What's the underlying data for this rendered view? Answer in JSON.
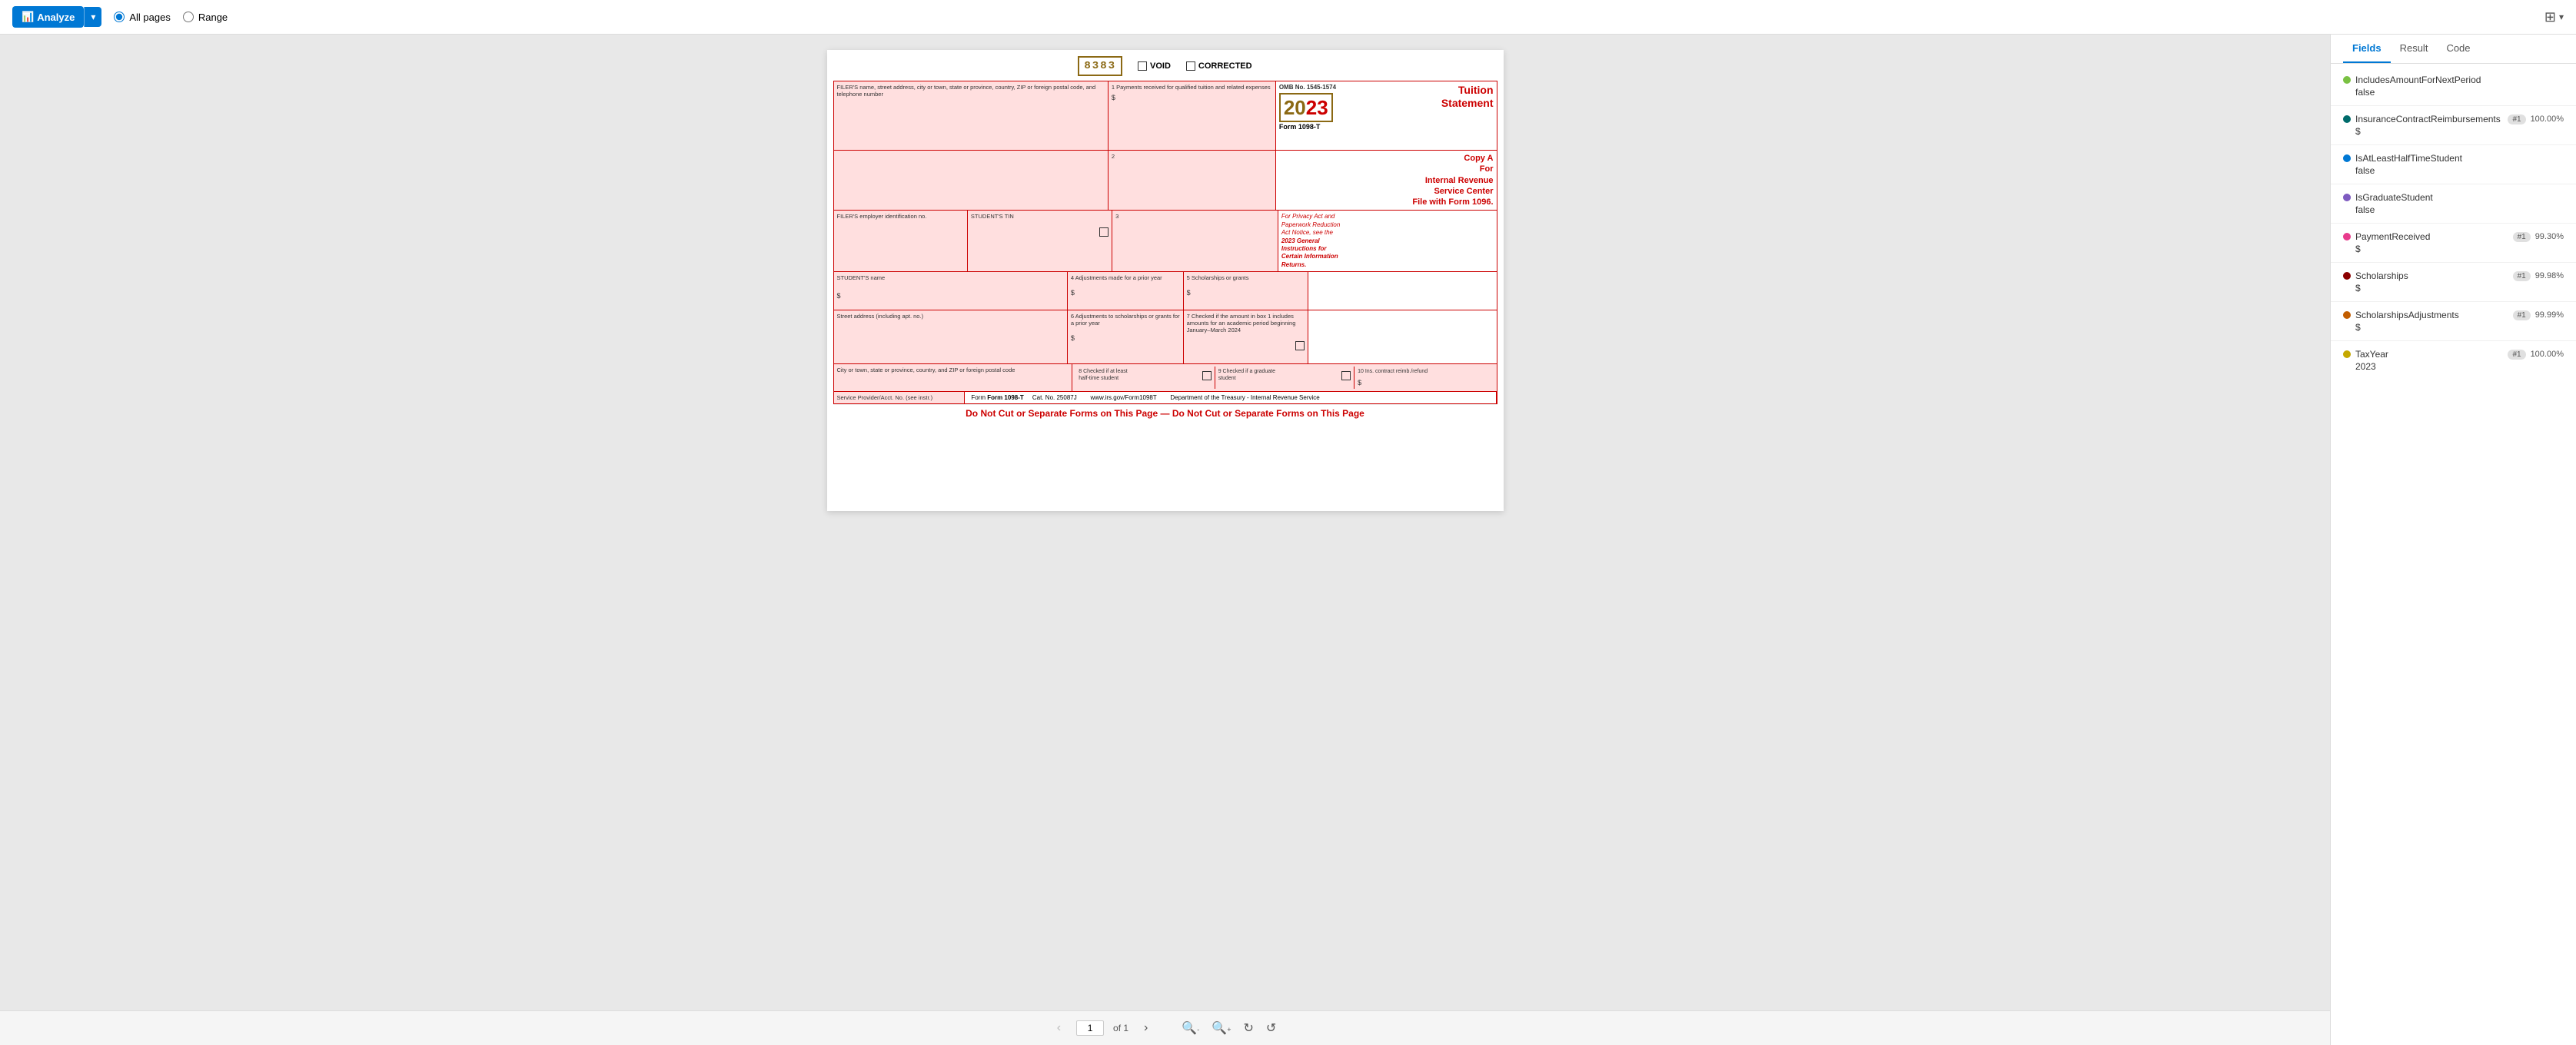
{
  "toolbar": {
    "analyze_label": "Analyze",
    "all_pages_label": "All pages",
    "range_label": "Range",
    "all_pages_selected": true
  },
  "pagination": {
    "current_page": "1",
    "of_label": "of 1",
    "prev_disabled": true,
    "next_disabled": true
  },
  "tabs": [
    {
      "id": "fields",
      "label": "Fields",
      "active": true
    },
    {
      "id": "result",
      "label": "Result",
      "active": false
    },
    {
      "id": "code",
      "label": "Code",
      "active": false
    }
  ],
  "fields": [
    {
      "name": "IncludesAmountForNextPeriod",
      "dot_color": "#7ac143",
      "badge": null,
      "confidence": null,
      "value": "false"
    },
    {
      "name": "InsuranceContractReimbursements",
      "dot_color": "#006b6b",
      "badge": "#1",
      "confidence": "100.00%",
      "value": "$"
    },
    {
      "name": "IsAtLeastHalfTimeStudent",
      "dot_color": "#0078d4",
      "badge": null,
      "confidence": null,
      "value": "false"
    },
    {
      "name": "IsGraduateStudent",
      "dot_color": "#7e5bc0",
      "badge": null,
      "confidence": null,
      "value": "false"
    },
    {
      "name": "PaymentReceived",
      "dot_color": "#e83b8c",
      "badge": "#1",
      "confidence": "99.30%",
      "value": "$"
    },
    {
      "name": "Scholarships",
      "dot_color": "#8B0000",
      "badge": "#1",
      "confidence": "99.98%",
      "value": "$"
    },
    {
      "name": "ScholarshipsAdjustments",
      "dot_color": "#c25d00",
      "badge": "#1",
      "confidence": "99.99%",
      "value": "$"
    },
    {
      "name": "TaxYear",
      "dot_color": "#c5a800",
      "badge": "#1",
      "confidence": "100.00%",
      "value": "2023"
    }
  ],
  "form": {
    "barcode": "8383",
    "void_label": "VOID",
    "corrected_label": "CORRECTED",
    "omb_no": "OMB No. 1545-1574",
    "year": "2023",
    "title": "Tuition\nStatement",
    "form_number": "Form 1098-T",
    "copy_text": "Copy A\nFor\nInternal Revenue\nService Center\nFile with Form 1096.",
    "instructions_text": "For Privacy Act and\nPaperwork Reduction\nAct Notice, see the\n2023 General\nInstructions for\nCertain Information\nReturns.",
    "filer_name_label": "FILER'S name, street address, city or town, state or province, country, ZIP or foreign postal code, and telephone number",
    "box1_label": "1 Payments received for qualified tuition and related expenses",
    "box2_label": "2",
    "box3_label": "3",
    "box4_label": "4 Adjustments made for a prior year",
    "box5_label": "5 Scholarships or grants",
    "box6_label": "6 Adjustments to scholarships or grants for a prior year",
    "box7_label": "7 Checked if the amount in box 1 includes amounts for an academic period beginning January–March 2024",
    "box8_label": "8 Checked if at least half-time student",
    "box9_label": "9 Checked if a graduate student",
    "box10_label": "10 Ins. contract reimb./refund",
    "filer_ein_label": "FILER'S employer identification no.",
    "student_tin_label": "STUDENT'S TIN",
    "student_name_label": "STUDENT'S name",
    "street_label": "Street address (including apt. no.)",
    "city_label": "City or town, state or province, country, and ZIP or foreign postal code",
    "service_provider_label": "Service Provider/Acct. No. (see instr.)",
    "footer_form": "Form 1098-T",
    "footer_cat": "Cat. No. 25087J",
    "footer_web": "www.irs.gov/Form1098T",
    "footer_dept": "Department of the Treasury - Internal Revenue Service",
    "do_not_cut": "Do Not Cut or Separate Forms on This Page — Do Not Cut or Separate Forms on This Page"
  }
}
